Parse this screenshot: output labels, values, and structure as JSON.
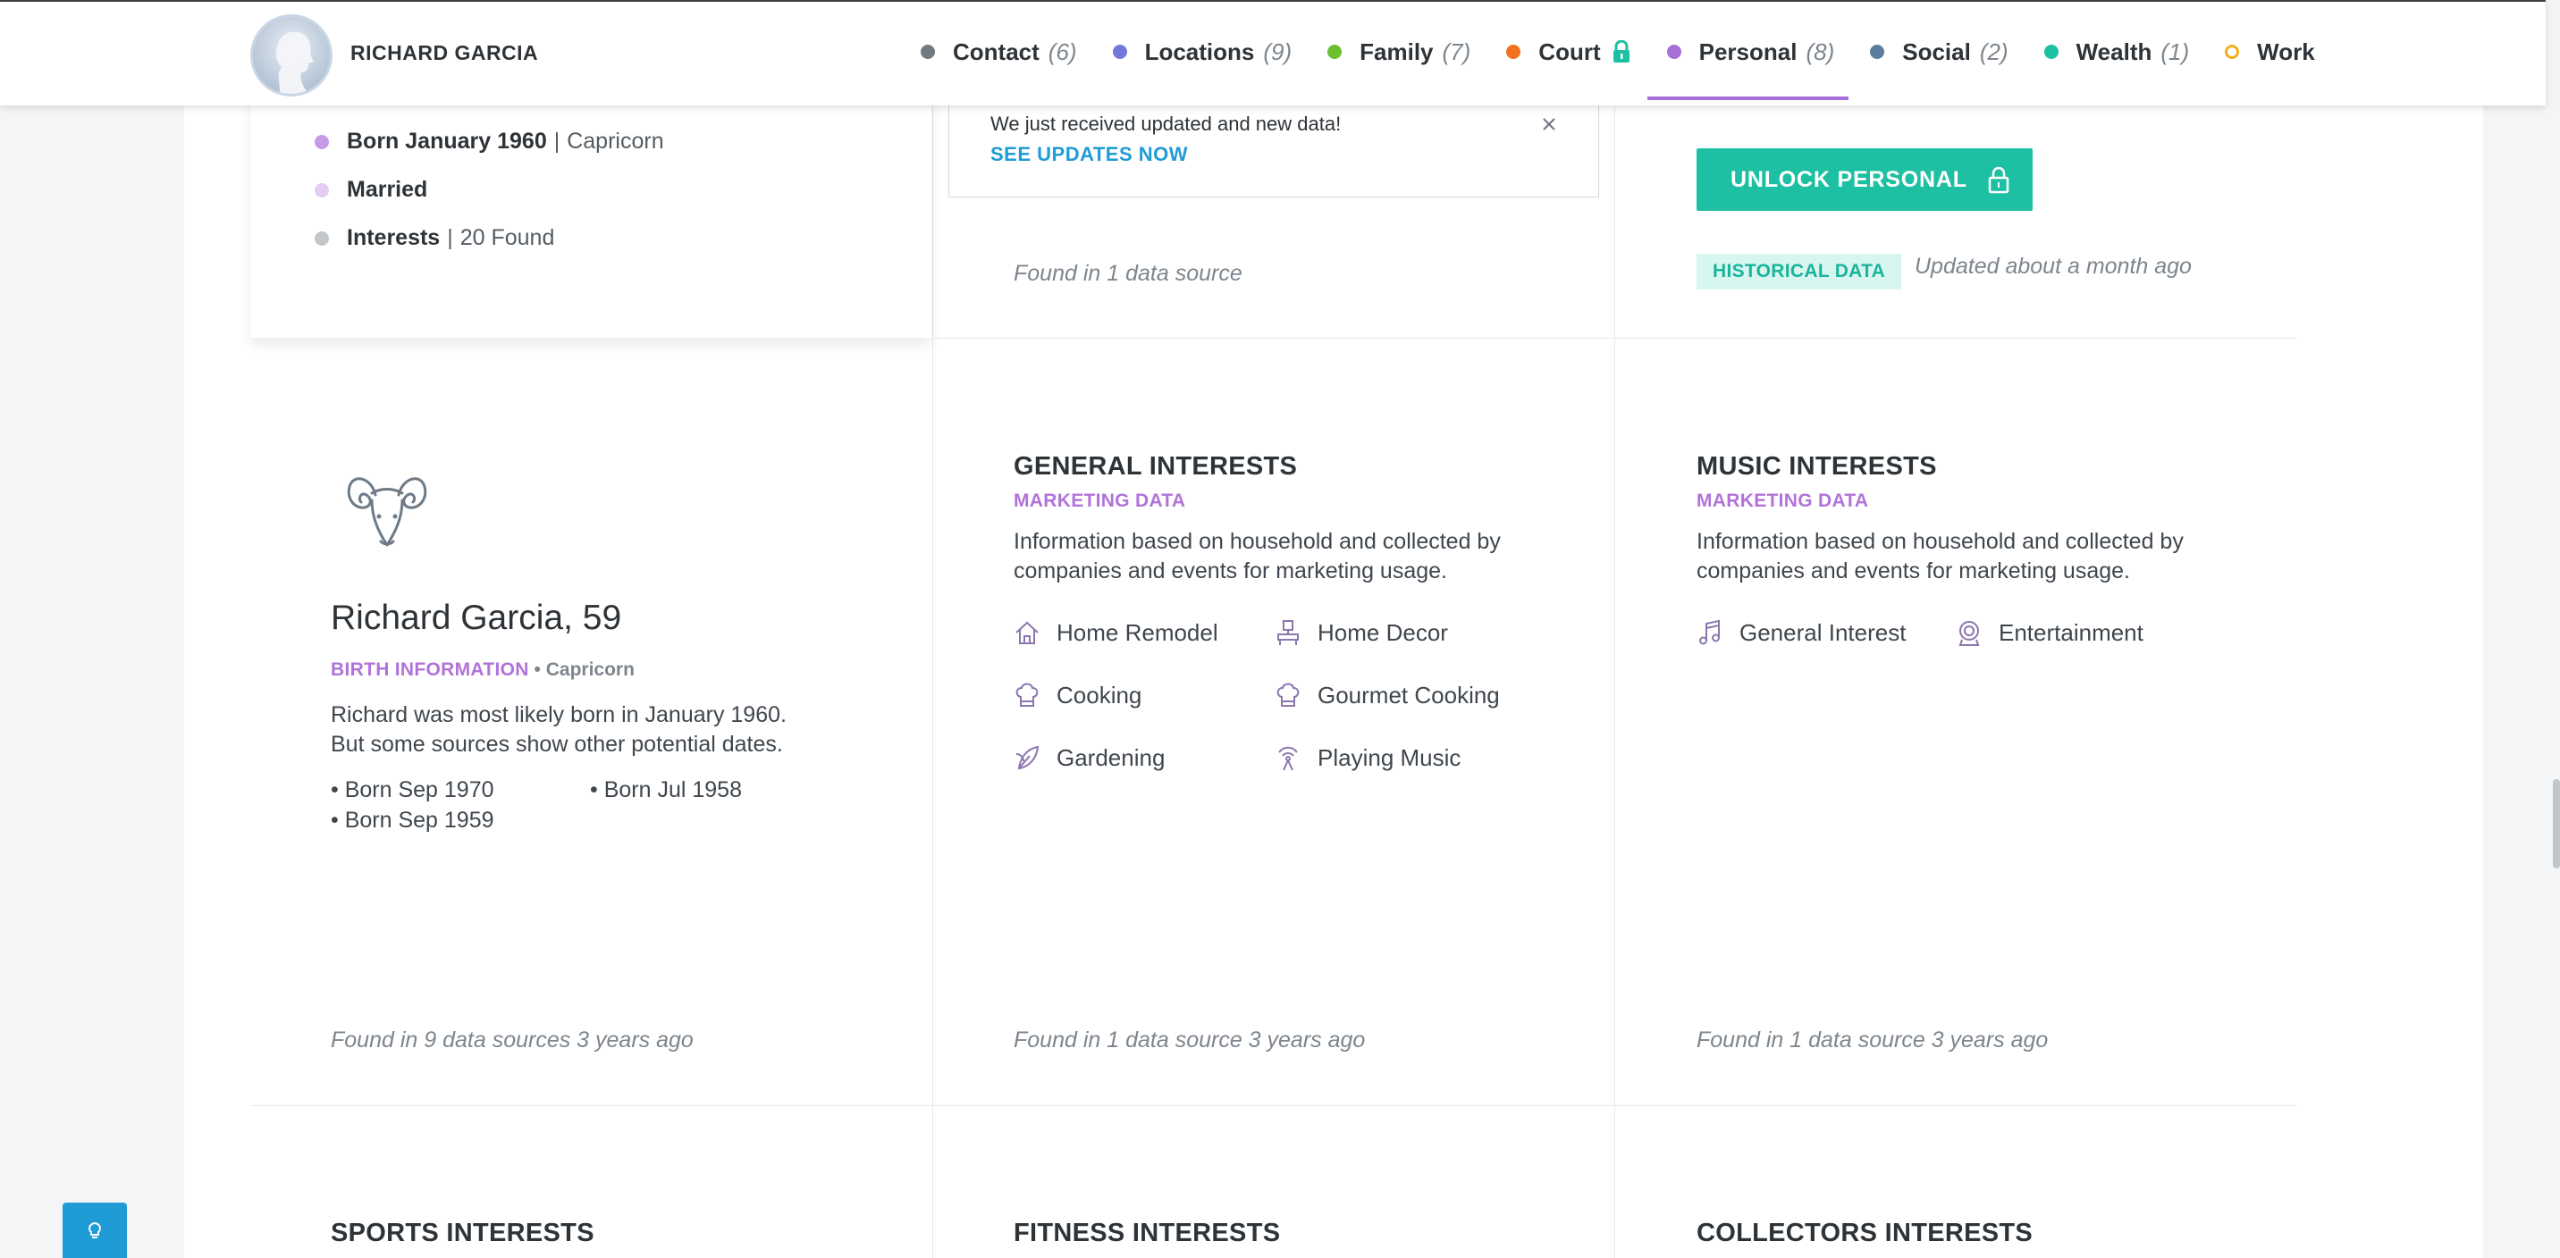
{
  "header": {
    "person_name": "RICHARD GARCIA",
    "nav": [
      {
        "label": "Contact",
        "count": "(6)",
        "color": "#707a84"
      },
      {
        "label": "Locations",
        "count": "(9)",
        "color": "#7478d9"
      },
      {
        "label": "Family",
        "count": "(7)",
        "color": "#6cbf2f"
      },
      {
        "label": "Court",
        "count": "",
        "color": "#f2711c"
      },
      {
        "label": "Personal",
        "count": "(8)",
        "color": "#a66fd6"
      },
      {
        "label": "Social",
        "count": "(2)",
        "color": "#5c7e9e"
      },
      {
        "label": "Wealth",
        "count": "(1)",
        "color": "#1ec0a3"
      },
      {
        "label": "Work",
        "count": "",
        "color": "#f2b01c"
      }
    ],
    "active_tab": "Personal"
  },
  "summary": {
    "born_label": "Born January 1960",
    "born_sign": "Capricorn",
    "married": "Married",
    "interests_label": "Interests",
    "interests_count": "20 Found",
    "dot_colors": [
      "#c89ae6",
      "#e3cdf3",
      "#c4c7ca"
    ]
  },
  "toast": {
    "message": "We just received updated and new data!",
    "link": "SEE UPDATES NOW"
  },
  "top_middle": {
    "found": "Found in 1 data source"
  },
  "top_right": {
    "unlock": "UNLOCK PERSONAL",
    "badge": "HISTORICAL DATA",
    "updated": "Updated about a month ago"
  },
  "birth": {
    "name": "Richard Garcia, 59",
    "sub_label": "BIRTH INFORMATION",
    "sub_sign": "• Capricorn",
    "desc_line1": "Richard was most likely born in January 1960.",
    "desc_line2": "But some sources show other potential dates.",
    "alt": [
      "• Born Sep 1970",
      "• Born Jul 1958",
      "• Born Sep 1959"
    ],
    "found": "Found in 9 data sources 3 years ago"
  },
  "general": {
    "title": "GENERAL INTERESTS",
    "sub": "MARKETING DATA",
    "desc_line1": "Information based on household and collected by",
    "desc_line2": "companies and events for marketing usage.",
    "items": [
      {
        "label": "Home Remodel",
        "icon": "home-remodel-icon"
      },
      {
        "label": "Home Decor",
        "icon": "home-decor-icon"
      },
      {
        "label": "Cooking",
        "icon": "chef-hat-icon"
      },
      {
        "label": "Gourmet Cooking",
        "icon": "chef-hat-icon"
      },
      {
        "label": "Gardening",
        "icon": "leaf-icon"
      },
      {
        "label": "Playing Music",
        "icon": "broadcast-icon"
      }
    ],
    "found": "Found in 1 data source 3 years ago"
  },
  "music": {
    "title": "MUSIC INTERESTS",
    "sub": "MARKETING DATA",
    "desc_line1": "Information based on household and collected by",
    "desc_line2": "companies and events for marketing usage.",
    "items": [
      {
        "label": "General Interest",
        "icon": "music-note-icon"
      },
      {
        "label": "Entertainment",
        "icon": "theater-icon"
      }
    ],
    "found": "Found in 1 data source 3 years ago"
  },
  "bottom_titles": [
    "SPORTS INTERESTS",
    "FITNESS INTERESTS",
    "COLLECTORS INTERESTS"
  ]
}
